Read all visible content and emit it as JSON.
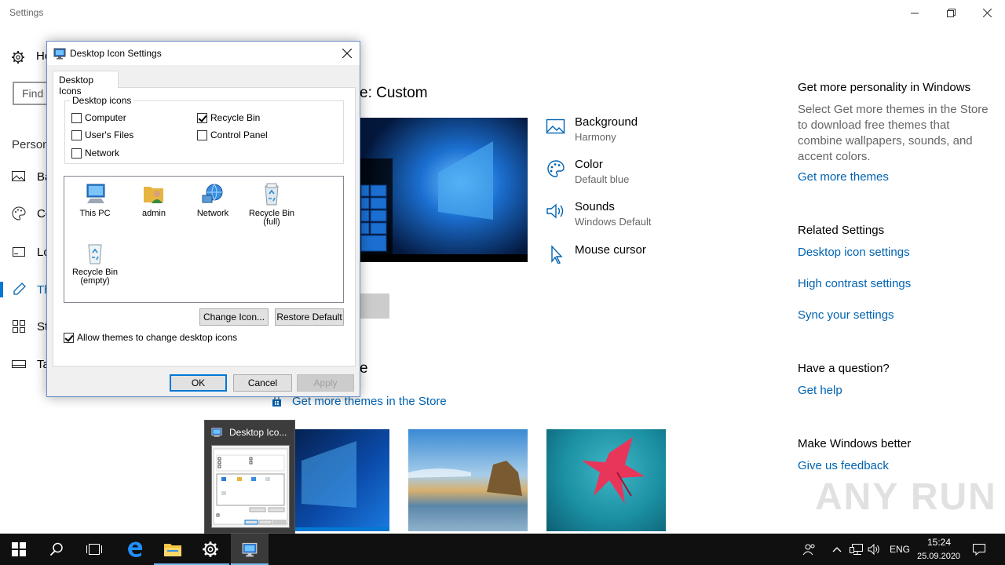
{
  "settings": {
    "app_title": "Settings",
    "nav": {
      "home_label": "Ho",
      "search_placeholder": "Find",
      "section": "Person",
      "items": [
        {
          "label": "Ba",
          "icon": "picture-icon"
        },
        {
          "label": "Co",
          "icon": "palette-icon"
        },
        {
          "label": "Lo",
          "icon": "lock-screen-icon"
        },
        {
          "label": "Th",
          "icon": "themes-icon",
          "selected": true
        },
        {
          "label": "St",
          "icon": "start-icon"
        },
        {
          "label": "Ta",
          "icon": "taskbar-icon"
        }
      ]
    },
    "main": {
      "title": "e: Custom",
      "properties": [
        {
          "title": "Background",
          "sub": "Harmony",
          "icon": "picture-icon"
        },
        {
          "title": "Color",
          "sub": "Default blue",
          "icon": "palette-icon"
        },
        {
          "title": "Sounds",
          "sub": "Windows Default",
          "icon": "speaker-icon"
        },
        {
          "title": "Mouse cursor",
          "sub": "",
          "icon": "cursor-icon"
        }
      ],
      "change_heading": "e",
      "store_link": "Get more themes in the Store"
    },
    "right": {
      "personality_heading": "Get more personality in Windows",
      "personality_text": "Select Get more themes in the Store to download free themes that combine wallpapers, sounds, and accent colors.",
      "get_more_themes": "Get more themes",
      "related_heading": "Related Settings",
      "desktop_icon_settings": "Desktop icon settings",
      "high_contrast_settings": "High contrast settings",
      "sync_settings": "Sync your settings",
      "question_heading": "Have a question?",
      "get_help": "Get help",
      "better_heading": "Make Windows better",
      "feedback": "Give us feedback"
    },
    "watermark": "ANY RUN"
  },
  "dialog": {
    "title": "Desktop Icon Settings",
    "tab": "Desktop Icons",
    "group_label": "Desktop icons",
    "checkboxes": [
      {
        "label": "Computer",
        "checked": false
      },
      {
        "label": "User's Files",
        "checked": false
      },
      {
        "label": "Network",
        "checked": false
      },
      {
        "label": "Recycle Bin",
        "checked": true
      },
      {
        "label": "Control Panel",
        "checked": false
      }
    ],
    "icons": [
      {
        "label": "This PC",
        "icon": "monitor-icon"
      },
      {
        "label": "admin",
        "icon": "user-folder-icon"
      },
      {
        "label": "Network",
        "icon": "network-globe-icon"
      },
      {
        "label": "Recycle Bin (full)",
        "icon": "recycle-bin-full-icon"
      },
      {
        "label": "Recycle Bin (empty)",
        "icon": "recycle-bin-empty-icon"
      }
    ],
    "change_icon": "Change Icon...",
    "restore_default": "Restore Default",
    "allow_themes": "Allow themes to change desktop icons",
    "allow_themes_checked": true,
    "ok": "OK",
    "cancel": "Cancel",
    "apply": "Apply"
  },
  "task_preview": {
    "title": "Desktop Ico..."
  },
  "taskbar": {
    "time": "15:24",
    "date": "25.09.2020",
    "language": "ENG"
  },
  "colors": {
    "accent": "#0078d4",
    "link": "#0063b1",
    "taskbar": "#101010"
  }
}
